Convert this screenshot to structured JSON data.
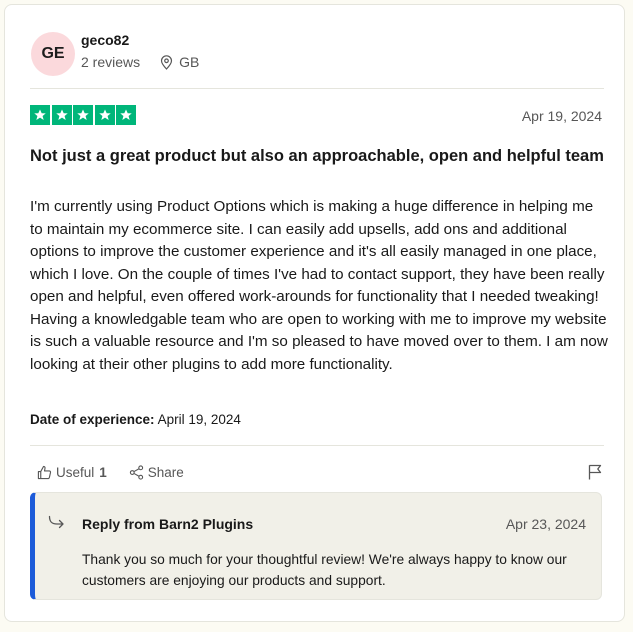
{
  "reviewer": {
    "initials": "GE",
    "name": "geco82",
    "reviews_count": "2 reviews",
    "country": "GB"
  },
  "review": {
    "rating": 5,
    "date": "Apr 19, 2024",
    "title": "Not just a great product but also an approachable, open and helpful team",
    "body": "I'm currently using Product Options which is making a huge difference in helping me to maintain my ecommerce site. I can easily add upsells, add ons and additional options to improve the customer experience and it's all easily managed in one place, which I love. On the couple of times I've had to contact support, they have been really open and helpful, even offered work-arounds for functionality that I needed tweaking! Having a knowledgable team who are open to working with me to improve my website is such a valuable resource and I'm so pleased to have moved over to them. I am now looking at their other plugins to add more functionality.",
    "experience_label": "Date of experience:",
    "experience_date": "April 19, 2024"
  },
  "actions": {
    "useful_label": "Useful",
    "useful_count": "1",
    "share_label": "Share"
  },
  "reply": {
    "title": "Reply from Barn2 Plugins",
    "date": "Apr 23, 2024",
    "text": "Thank you so much for your thoughtful review! We're always happy to know our customers are enjoying our products and support."
  },
  "colors": {
    "star_green": "#00b67a",
    "avatar_bg": "#fbd9dc",
    "reply_accent": "#1c5bd9",
    "reply_bg": "#f1f0e8"
  }
}
